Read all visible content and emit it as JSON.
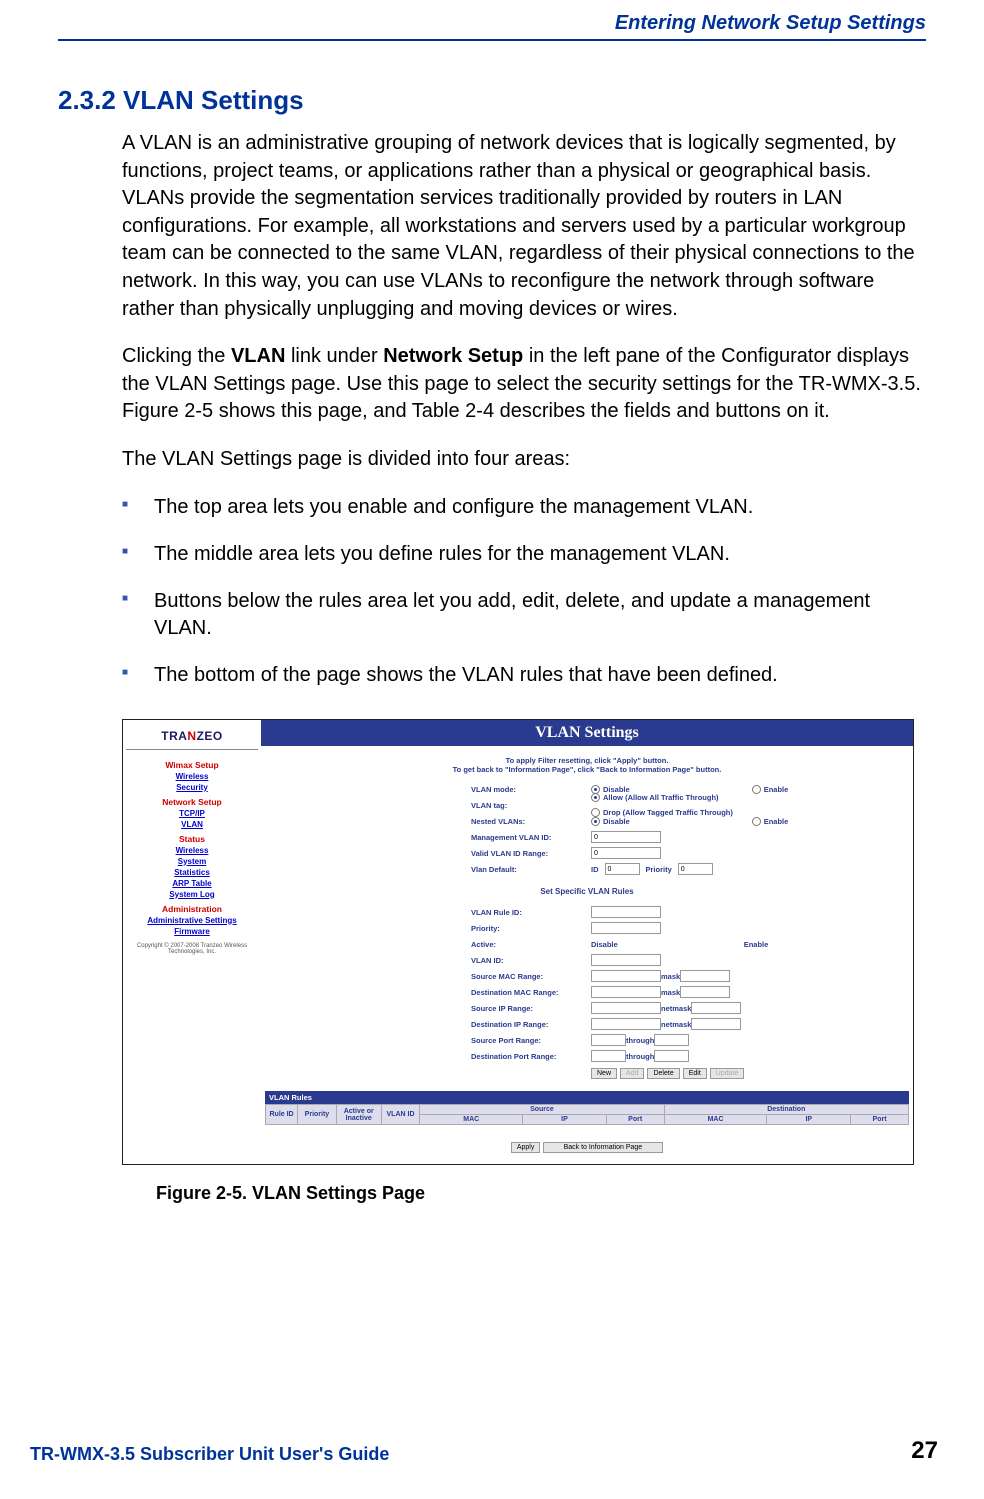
{
  "chapter_header": "Entering Network Setup Settings",
  "heading": "2.3.2 VLAN Settings",
  "p1": "A VLAN is an administrative grouping of network devices that is logically segmented, by functions, project teams, or applications rather than a physical or geographical basis. VLANs provide the segmentation services traditionally provided by routers in LAN configurations. For example, all workstations and servers used by a particular workgroup team can be connected to the same VLAN, regardless of their physical connections to the network. In this way, you can use VLANs to reconfigure the network through software rather than physically unplugging and moving devices or wires.",
  "p2a": "Clicking the ",
  "p2_vlan": "VLAN",
  "p2b": " link under ",
  "p2_net": "Network Setup",
  "p2c": " in the left pane of the Configurator displays the VLAN Settings page. Use this page to select the security settings for the TR-WMX-3.5. Figure 2‑5 shows this page, and Table 2‑4 describes the fields and buttons on it.",
  "p3": "The VLAN Settings page is divided into four areas:",
  "bullets": [
    "The top area lets you enable and configure the management VLAN.",
    "The middle area lets you define rules for the management VLAN.",
    "Buttons below the rules area let you add, edit, delete, and update a management VLAN.",
    "The bottom of the page shows the VLAN rules that have been defined."
  ],
  "screenshot": {
    "logo_prefix": "TRA",
    "logo_n": "N",
    "logo_suffix": "ZEO",
    "nav": {
      "wimax": "Wimax Setup",
      "wireless": "Wireless",
      "security": "Security",
      "netsetup": "Network Setup",
      "tcpip": "TCP/IP",
      "vlan": "VLAN",
      "status": "Status",
      "wireless2": "Wireless",
      "system": "System",
      "statistics": "Statistics",
      "arp": "ARP Table",
      "syslog": "System Log",
      "admin": "Administration",
      "adminset": "Administrative Settings",
      "firmware": "Firmware",
      "copyright": "Copyright © 2007-2008 Tranzeo Wireless Technologies, Inc."
    },
    "title": "VLAN Settings",
    "notice_l1": "To apply Filter resetting, click \"Apply\" button.",
    "notice_l2": "To get back to \"Information Page\", click \"Back to Information Page\" button.",
    "labels": {
      "vlan_mode": "VLAN mode:",
      "vlan_tag": "VLAN tag:",
      "nested": "Nested VLANs:",
      "mgmt_id": "Management VLAN ID:",
      "valid_range": "Valid VLAN ID Range:",
      "vlan_default": "Vlan Default:",
      "rule_id": "VLAN Rule ID:",
      "priority": "Priority:",
      "active": "Active:",
      "vlan_id": "VLAN ID:",
      "src_mac": "Source MAC Range:",
      "dst_mac": "Destination MAC Range:",
      "src_ip": "Source IP Range:",
      "dst_ip": "Destination IP Range:",
      "src_port": "Source Port Range:",
      "dst_port": "Destination Port Range:"
    },
    "options": {
      "disable": "Disable",
      "enable": "Enable",
      "allow": "Allow (Allow All Traffic Through)",
      "drop": "Drop (Allow Tagged Traffic Through)",
      "id_lbl": "ID",
      "priority_lbl": "Priority",
      "mask": "mask",
      "netmask": "netmask",
      "through": "through"
    },
    "values": {
      "mgmt_id": "0",
      "valid_range": "0",
      "default_id": "0",
      "default_prio": "0"
    },
    "subhead": "Set Specific VLAN Rules",
    "buttons": {
      "new": "New",
      "add": "Add",
      "delete": "Delete",
      "edit": "Edit",
      "update": "Update"
    },
    "rules_head": "VLAN Rules",
    "table": {
      "rule_id": "Rule ID",
      "priority": "Priority",
      "active": "Active or Inactive",
      "vlan_id": "VLAN ID",
      "source": "Source",
      "dest": "Destination",
      "mac": "MAC",
      "ip": "IP",
      "port": "Port"
    },
    "bottom": {
      "apply": "Apply",
      "back": "Back to Information Page"
    }
  },
  "caption": "Figure 2-5. VLAN Settings Page",
  "footer_title": "TR-WMX-3.5 Subscriber Unit User's Guide",
  "page_number": "27"
}
